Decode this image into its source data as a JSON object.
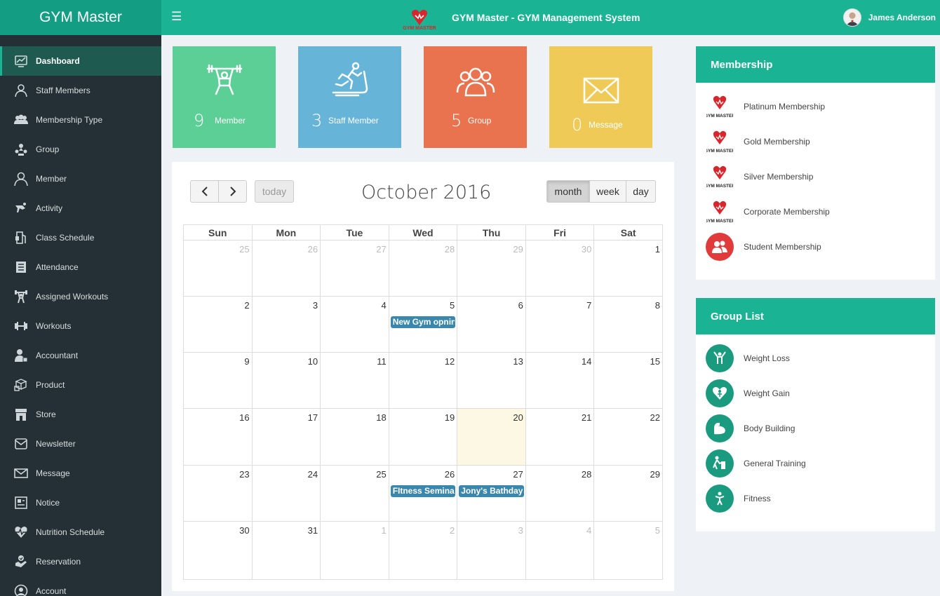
{
  "brand": "GYM Master",
  "header": {
    "title": "GYM Master - GYM Management System",
    "logo_text": "GYM MASTER",
    "user_name": "James Anderson"
  },
  "colors": {
    "primary": "#1ab394",
    "sidebar": "#243035",
    "member_tile": "#5ccf96",
    "staff_tile": "#67b4d9",
    "group_tile": "#e9734f",
    "message_tile": "#efca57",
    "event": "#3a87ad",
    "today": "#fcf8e3"
  },
  "sidebar": {
    "items": [
      {
        "label": "Dashboard",
        "icon": "dashboard-icon",
        "active": true
      },
      {
        "label": "Staff Members",
        "icon": "staff-icon"
      },
      {
        "label": "Membership Type",
        "icon": "membership-icon"
      },
      {
        "label": "Group",
        "icon": "group-icon"
      },
      {
        "label": "Member",
        "icon": "member-icon"
      },
      {
        "label": "Activity",
        "icon": "activity-icon"
      },
      {
        "label": "Class Schedule",
        "icon": "class-schedule-icon"
      },
      {
        "label": "Attendance",
        "icon": "attendance-icon"
      },
      {
        "label": "Assigned Workouts",
        "icon": "assigned-workouts-icon"
      },
      {
        "label": "Workouts",
        "icon": "workouts-icon"
      },
      {
        "label": "Accountant",
        "icon": "accountant-icon"
      },
      {
        "label": "Product",
        "icon": "product-icon"
      },
      {
        "label": "Store",
        "icon": "store-icon"
      },
      {
        "label": "Newsletter",
        "icon": "newsletter-icon"
      },
      {
        "label": "Message",
        "icon": "message-icon"
      },
      {
        "label": "Notice",
        "icon": "notice-icon"
      },
      {
        "label": "Nutrition Schedule",
        "icon": "nutrition-icon"
      },
      {
        "label": "Reservation",
        "icon": "reservation-icon"
      },
      {
        "label": "Account",
        "icon": "account-icon"
      }
    ]
  },
  "stats": [
    {
      "count": "9",
      "label": "Member",
      "icon": "weightlifter-icon"
    },
    {
      "count": "3",
      "label": "Staff Member",
      "icon": "treadmill-icon"
    },
    {
      "count": "5",
      "label": "Group",
      "icon": "people-icon"
    },
    {
      "count": "0",
      "label": "Message",
      "icon": "envelope-icon"
    }
  ],
  "calendar": {
    "title": "October 2016",
    "today_label": "today",
    "views": [
      "month",
      "week",
      "day"
    ],
    "active_view": "month",
    "weekdays": [
      "Sun",
      "Mon",
      "Tue",
      "Wed",
      "Thu",
      "Fri",
      "Sat"
    ],
    "weeks": [
      [
        {
          "d": "25",
          "o": true
        },
        {
          "d": "26",
          "o": true
        },
        {
          "d": "27",
          "o": true
        },
        {
          "d": "28",
          "o": true
        },
        {
          "d": "29",
          "o": true
        },
        {
          "d": "30",
          "o": true
        },
        {
          "d": "1"
        }
      ],
      [
        {
          "d": "2"
        },
        {
          "d": "3"
        },
        {
          "d": "4"
        },
        {
          "d": "5",
          "event": "New Gym opning"
        },
        {
          "d": "6"
        },
        {
          "d": "7"
        },
        {
          "d": "8"
        }
      ],
      [
        {
          "d": "9"
        },
        {
          "d": "10"
        },
        {
          "d": "11"
        },
        {
          "d": "12"
        },
        {
          "d": "13"
        },
        {
          "d": "14"
        },
        {
          "d": "15"
        }
      ],
      [
        {
          "d": "16"
        },
        {
          "d": "17"
        },
        {
          "d": "18"
        },
        {
          "d": "19"
        },
        {
          "d": "20",
          "today": true
        },
        {
          "d": "21"
        },
        {
          "d": "22"
        }
      ],
      [
        {
          "d": "23"
        },
        {
          "d": "24"
        },
        {
          "d": "25"
        },
        {
          "d": "26",
          "event": "FItness Seminar"
        },
        {
          "d": "27",
          "event": "Jony's Bathday"
        },
        {
          "d": "28"
        },
        {
          "d": "29"
        }
      ],
      [
        {
          "d": "30"
        },
        {
          "d": "31"
        },
        {
          "d": "1",
          "o": true
        },
        {
          "d": "2",
          "o": true
        },
        {
          "d": "3",
          "o": true
        },
        {
          "d": "4",
          "o": true
        },
        {
          "d": "5",
          "o": true
        }
      ]
    ]
  },
  "membership": {
    "title": "Membership",
    "items": [
      {
        "label": "Platinum Membership",
        "icon": "gym-master-logo-icon"
      },
      {
        "label": "Gold Membership",
        "icon": "gym-master-logo-icon"
      },
      {
        "label": "Silver Membership",
        "icon": "gym-master-logo-icon"
      },
      {
        "label": "Corporate Membership",
        "icon": "gym-master-logo-icon"
      },
      {
        "label": "Student Membership",
        "icon": "users-icon"
      }
    ]
  },
  "groups": {
    "title": "Group List",
    "items": [
      {
        "label": "Weight Loss",
        "icon": "weight-loss-icon"
      },
      {
        "label": "Weight Gain",
        "icon": "weight-gain-icon"
      },
      {
        "label": "Body Building",
        "icon": "body-building-icon"
      },
      {
        "label": "General Training",
        "icon": "general-training-icon"
      },
      {
        "label": "Fitness",
        "icon": "fitness-icon"
      }
    ]
  }
}
